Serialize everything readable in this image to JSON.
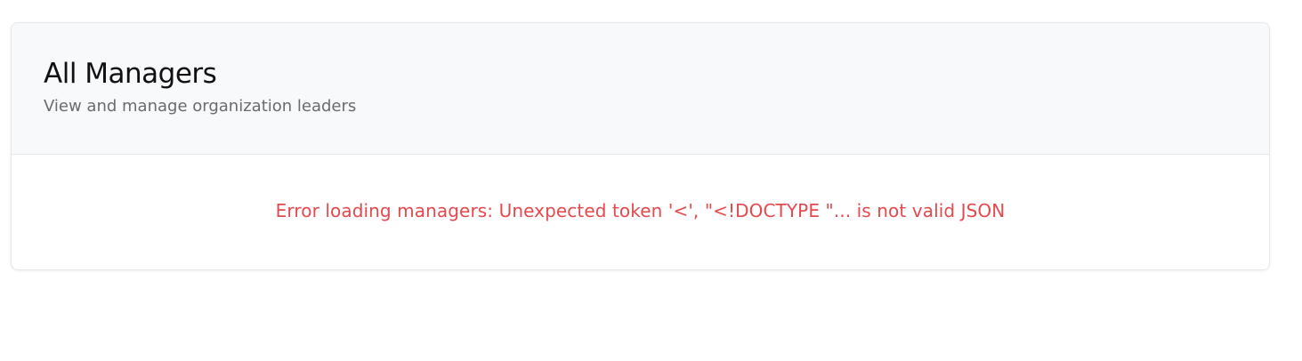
{
  "header": {
    "title": "All Managers",
    "subtitle": "View and manage organization leaders"
  },
  "body": {
    "error_message": "Error loading managers: Unexpected token '<', \"<!DOCTYPE \"... is not valid JSON"
  },
  "colors": {
    "error": "#e5484d",
    "header_bg": "#f8f9fb",
    "border": "#e5e7eb"
  }
}
